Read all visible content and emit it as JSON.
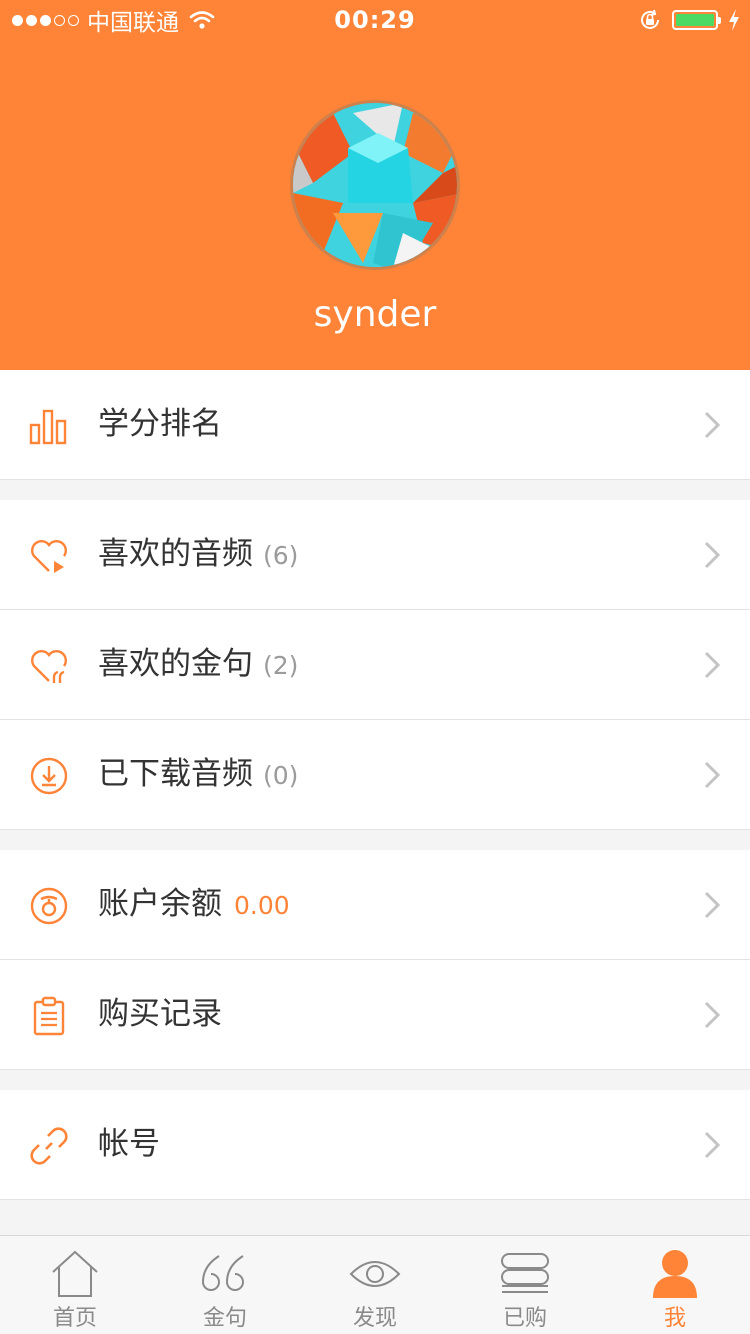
{
  "status_bar": {
    "carrier": "中国联通",
    "time": "00:29"
  },
  "profile": {
    "username": "synder"
  },
  "menu": {
    "ranking": {
      "label": "学分排名",
      "icon": "bar-chart-icon"
    },
    "liked_audio": {
      "label": "喜欢的音频",
      "count": "(6)",
      "icon": "heart-play-icon"
    },
    "liked_quotes": {
      "label": "喜欢的金句",
      "count": "(2)",
      "icon": "heart-quote-icon"
    },
    "downloaded_audio": {
      "label": "已下载音频",
      "count": "(0)",
      "icon": "download-icon"
    },
    "balance": {
      "label": "账户余额",
      "amount": "0.00",
      "icon": "coin-icon"
    },
    "purchase_history": {
      "label": "购买记录",
      "icon": "clipboard-icon"
    },
    "account": {
      "label": "帐号",
      "icon": "link-icon"
    }
  },
  "tabbar": {
    "home": "首页",
    "quotes": "金句",
    "discover": "发现",
    "purchased": "已购",
    "me": "我",
    "active": "me"
  },
  "colors": {
    "accent": "#ff8438",
    "inactive": "#8a8a8a"
  }
}
